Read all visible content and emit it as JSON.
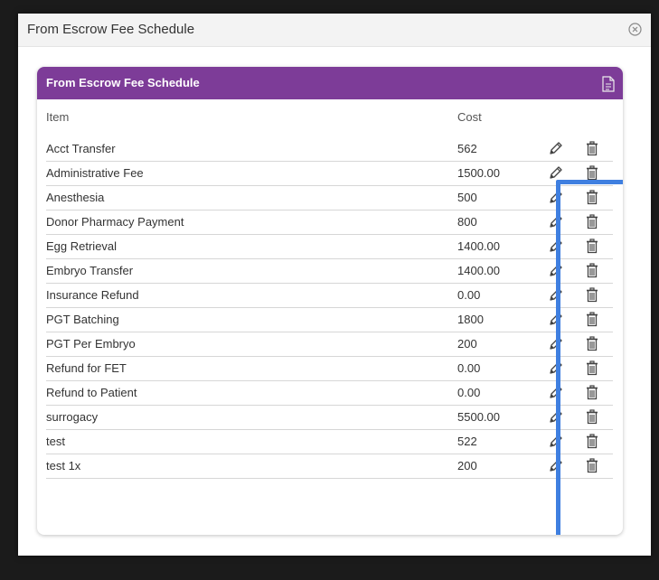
{
  "modal": {
    "title": "From Escrow Fee Schedule"
  },
  "panel": {
    "title": "From Escrow Fee Schedule",
    "columns": {
      "item": "Item",
      "cost": "Cost"
    },
    "rows": [
      {
        "item": "Acct Transfer",
        "cost": "562"
      },
      {
        "item": "Administrative Fee",
        "cost": "1500.00"
      },
      {
        "item": "Anesthesia",
        "cost": "500"
      },
      {
        "item": "Donor Pharmacy Payment",
        "cost": "800"
      },
      {
        "item": "Egg Retrieval",
        "cost": "1400.00"
      },
      {
        "item": "Embryo Transfer",
        "cost": "1400.00"
      },
      {
        "item": "Insurance Refund",
        "cost": "0.00"
      },
      {
        "item": "PGT Batching",
        "cost": "1800"
      },
      {
        "item": "PGT Per Embryo",
        "cost": "200"
      },
      {
        "item": "Refund for FET",
        "cost": "0.00"
      },
      {
        "item": "Refund to Patient",
        "cost": "0.00"
      },
      {
        "item": "surrogacy",
        "cost": "5500.00"
      },
      {
        "item": "test",
        "cost": "522"
      },
      {
        "item": "test 1x",
        "cost": "200"
      }
    ]
  },
  "colors": {
    "header": "#7d3c98",
    "highlight": "#3f7fe0"
  },
  "icons": {
    "close": "close-circle-icon",
    "export": "export-document-icon",
    "edit": "pencil-icon",
    "delete": "trash-icon"
  }
}
